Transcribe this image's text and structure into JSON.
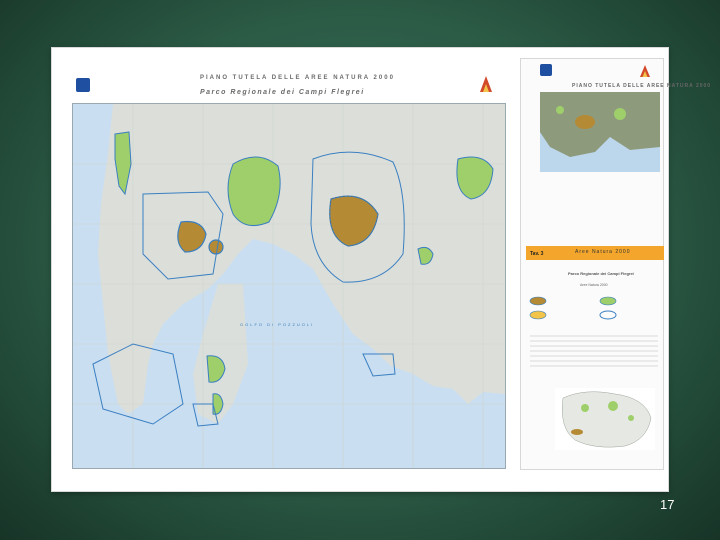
{
  "slide": {
    "number": "17"
  },
  "map": {
    "title": "PIANO TUTELA DELLE AREE NATURA 2000",
    "subtitle": "Parco Regionale dei Campi Flegrei",
    "sea_label": "GOLFO DI POZZUOLI",
    "side_title": "PIANO TUTELA DELLE AREE NATURA 2000",
    "tav_label": "Tav. 3",
    "acque_label": "Aree Natura 2000",
    "legend_heading": "Parco Regionale dei Campi Flegrei",
    "legend_sub": "Aree Natura 2000"
  },
  "colors": {
    "sea": "#c9def0",
    "land": "#d9ddd9",
    "green_areas": "#9fcf6a",
    "brown_areas": "#b58a34",
    "boundary": "#3a7fc2",
    "header_band": "#f3a62b"
  }
}
